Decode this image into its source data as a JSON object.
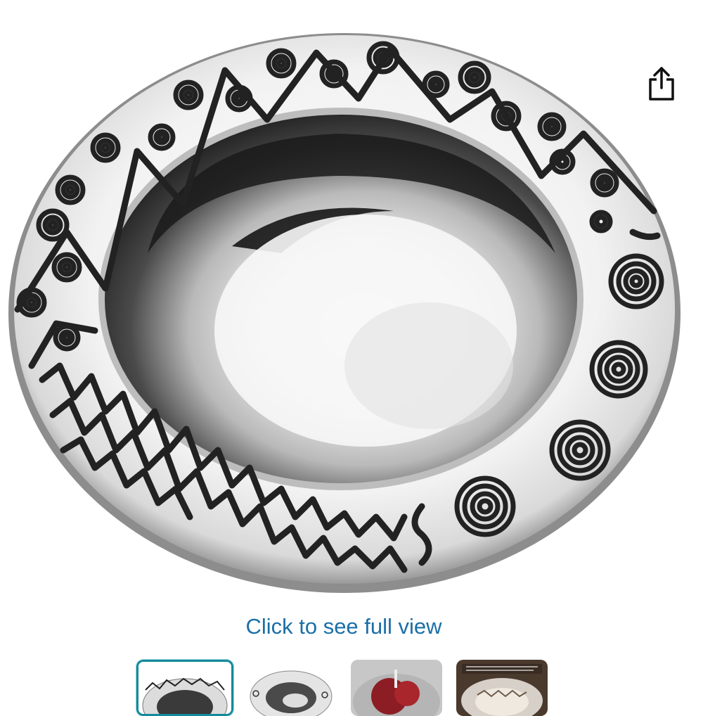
{
  "product_image": {
    "alt": "Pewter serving bowl with engraved spiral and zigzag rim"
  },
  "share": {
    "icon": "share-icon"
  },
  "view_link": {
    "label": "Click to see full view"
  },
  "thumbnails": [
    {
      "name": "thumbnail-1",
      "selected": true
    },
    {
      "name": "thumbnail-2",
      "selected": false
    },
    {
      "name": "thumbnail-3",
      "selected": false
    },
    {
      "name": "thumbnail-4",
      "selected": false
    }
  ],
  "colors": {
    "link": "#1a6fa8",
    "selected_border": "#148a9b",
    "engraving": "#222222"
  }
}
